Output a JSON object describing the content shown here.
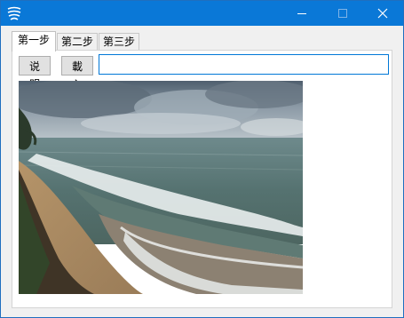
{
  "window": {
    "title": "",
    "icon": "app-logo-icon",
    "accent": "#0a78d7"
  },
  "caption_buttons": {
    "minimize_icon": "minimize-icon",
    "maximize_icon": "maximize-icon",
    "close_icon": "close-icon"
  },
  "tabs": [
    {
      "label": "第一步",
      "active": true
    },
    {
      "label": "第二步",
      "active": false
    },
    {
      "label": "第三步",
      "active": false
    }
  ],
  "toolbar": {
    "explain_label": "说明",
    "load_label": "載入",
    "path_value": ""
  },
  "image": {
    "description": "beach-photo"
  }
}
